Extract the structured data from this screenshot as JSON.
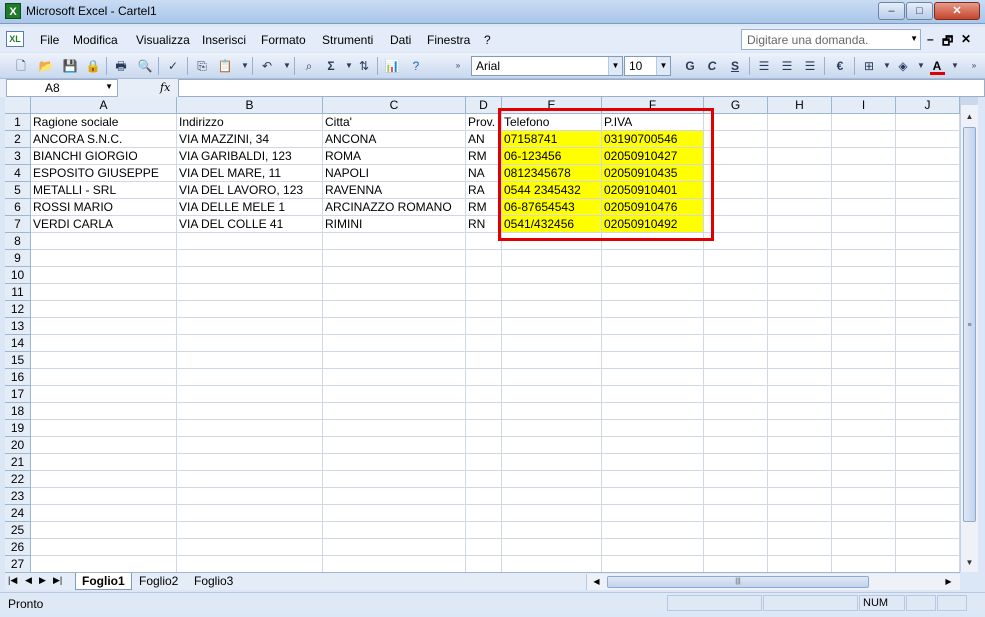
{
  "window": {
    "title": "Microsoft Excel - Cartel1",
    "app_icon": "X",
    "minimize": "–",
    "maximize": "□",
    "close": "✕"
  },
  "menu": {
    "items": [
      "File",
      "Modifica",
      "Visualizza",
      "Inserisci",
      "Formato",
      "Strumenti",
      "Dati",
      "Finestra",
      "?"
    ],
    "help_placeholder": "Digitare una domanda.",
    "doc_minimize": "–",
    "doc_restore": "🗗",
    "doc_close": "✕"
  },
  "toolbar": {
    "font_name": "Arial",
    "font_size": "10",
    "bold": "G",
    "italic": "C",
    "underline": "S",
    "sum": "Σ",
    "currency": "€",
    "font_color_letter": "A"
  },
  "formula_bar": {
    "name_box": "A8",
    "fx": "fx",
    "value": ""
  },
  "sheet": {
    "columns": [
      "A",
      "B",
      "C",
      "D",
      "E",
      "F",
      "G",
      "H",
      "I",
      "J"
    ],
    "row_numbers": [
      "1",
      "2",
      "3",
      "4",
      "5",
      "6",
      "7",
      "8",
      "9",
      "10",
      "11",
      "12",
      "13",
      "14",
      "15",
      "16",
      "17",
      "18",
      "19",
      "20",
      "21",
      "22",
      "23",
      "24",
      "25",
      "26",
      "27"
    ],
    "rows": [
      [
        "Ragione sociale",
        "Indirizzo",
        "Citta'",
        "Prov.",
        "Telefono",
        "P.IVA"
      ],
      [
        "ANCORA S.N.C.",
        "VIA MAZZINI, 34",
        "ANCONA",
        "AN",
        "07158741",
        "03190700546"
      ],
      [
        "BIANCHI GIORGIO",
        "VIA GARIBALDI, 123",
        "ROMA",
        "RM",
        "06-123456",
        "02050910427"
      ],
      [
        "ESPOSITO GIUSEPPE",
        "VIA DEL MARE, 11",
        "NAPOLI",
        "NA",
        "0812345678",
        "02050910435"
      ],
      [
        "METALLI - SRL",
        "VIA DEL LAVORO, 123",
        "RAVENNA",
        "RA",
        "0544 2345432",
        "02050910401"
      ],
      [
        "ROSSI MARIO",
        "VIA DELLE MELE 1",
        "ARCINAZZO ROMANO",
        "RM",
        "06-87654543",
        "02050910476"
      ],
      [
        "VERDI CARLA",
        "VIA DEL COLLE 41",
        "RIMINI",
        "RN",
        "0541/432456",
        "02050910492"
      ]
    ],
    "highlight_color": "#ffff00",
    "selection_border_color": "#e00000"
  },
  "tabs": {
    "sheets": [
      "Foglio1",
      "Foglio2",
      "Foglio3"
    ],
    "active": "Foglio1"
  },
  "status": {
    "text": "Pronto",
    "num": "NUM"
  }
}
